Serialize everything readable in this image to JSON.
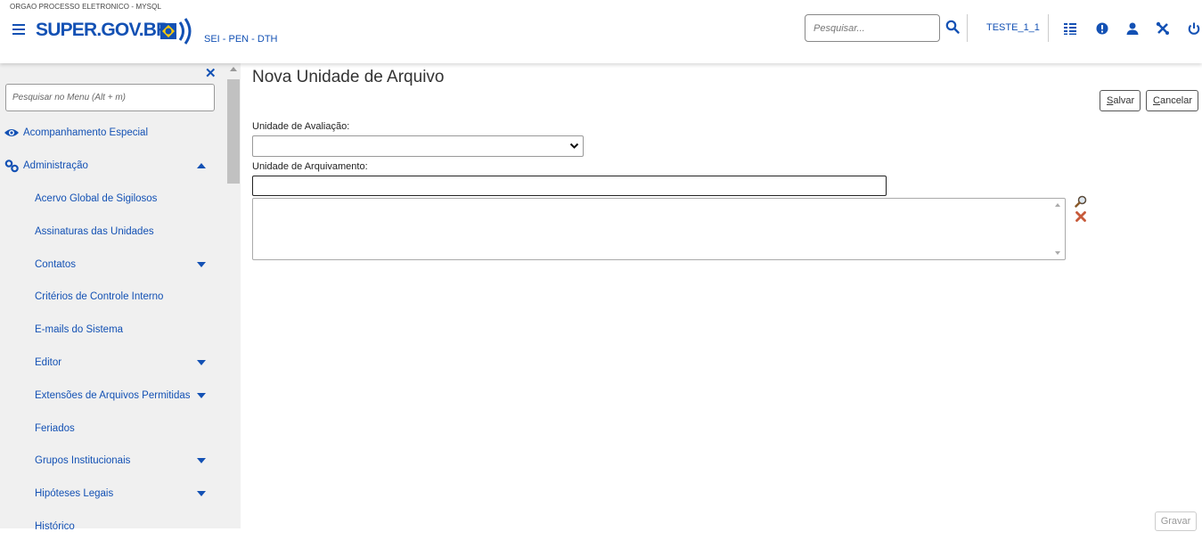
{
  "header": {
    "org_label": "ORGAO PROCESSO ELETRONICO - MYSQL",
    "logo_text": "SUPER.GOV.BR",
    "subsystem": "SEI - PEN - DTH",
    "search_placeholder": "Pesquisar...",
    "user": "TESTE_1_1",
    "icons": [
      "menu-icon",
      "search-icon",
      "units-list-icon",
      "alert-icon",
      "user-icon",
      "tools-icon",
      "power-icon"
    ]
  },
  "sidebar": {
    "search_placeholder": "Pesquisar no Menu (Alt + m)",
    "items": [
      {
        "label": "Acompanhamento Especial",
        "level": "top",
        "icon": "eye-icon"
      },
      {
        "label": "Administração",
        "level": "top",
        "icon": "gears-icon",
        "expanded": true
      },
      {
        "label": "Acervo Global de Sigilosos",
        "level": "sub"
      },
      {
        "label": "Assinaturas das Unidades",
        "level": "sub"
      },
      {
        "label": "Contatos",
        "level": "sub",
        "has_children": true
      },
      {
        "label": "Critérios de Controle Interno",
        "level": "sub"
      },
      {
        "label": "E-mails do Sistema",
        "level": "sub"
      },
      {
        "label": "Editor",
        "level": "sub",
        "has_children": true
      },
      {
        "label": "Extensões de Arquivos Permitidas",
        "level": "sub",
        "has_children": true
      },
      {
        "label": "Feriados",
        "level": "sub"
      },
      {
        "label": "Grupos Institucionais",
        "level": "sub",
        "has_children": true
      },
      {
        "label": "Hipóteses Legais",
        "level": "sub",
        "has_children": true
      },
      {
        "label": "Histórico",
        "level": "sub"
      }
    ]
  },
  "main": {
    "title": "Nova Unidade de Arquivo",
    "buttons": {
      "save": "Salvar",
      "save_rest": "alvar",
      "save_key": "S",
      "cancel": "Cancelar",
      "cancel_key": "C",
      "cancel_rest": "ancelar",
      "gravar": "Gravar"
    },
    "fields": {
      "evaluation_unit_label": "Unidade de Avaliação:",
      "evaluation_unit_value": "",
      "archive_unit_label": "Unidade de Arquivamento:",
      "archive_unit_value": ""
    }
  },
  "colors": {
    "accent": "#1351b4",
    "sidebar_bg": "#f0f0f0"
  }
}
